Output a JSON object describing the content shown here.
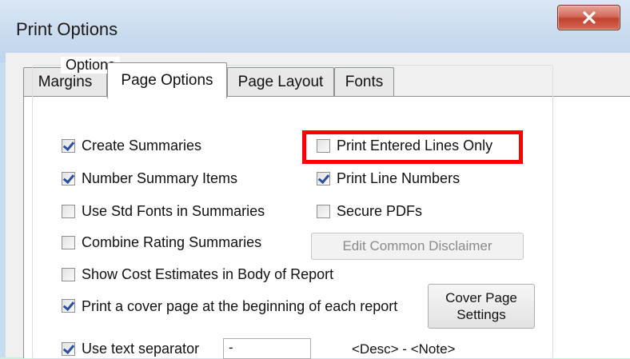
{
  "window": {
    "title": "Print Options",
    "close_label": "X"
  },
  "tabs": [
    {
      "label": "Margins",
      "active": false
    },
    {
      "label": "Page Options",
      "active": true
    },
    {
      "label": "Page Layout",
      "active": false
    },
    {
      "label": "Fonts",
      "active": false
    }
  ],
  "options_group": {
    "legend": "Options",
    "create_summaries": {
      "label": "Create Summaries",
      "checked": true
    },
    "number_summary_items": {
      "label": "Number Summary Items",
      "checked": true
    },
    "use_std_fonts": {
      "label": "Use Std Fonts in Summaries",
      "checked": false
    },
    "combine_rating": {
      "label": "Combine Rating Summaries",
      "checked": false
    },
    "show_cost": {
      "label": "Show Cost Estimates in Body of Report",
      "checked": false
    },
    "print_cover": {
      "label": "Print a cover page at the beginning of each report",
      "checked": true
    },
    "use_text_separator": {
      "label": "Use text separator",
      "checked": true
    },
    "print_entered_lines": {
      "label": "Print Entered Lines Only",
      "checked": false
    },
    "print_line_numbers": {
      "label": "Print Line Numbers",
      "checked": true
    },
    "secure_pdfs": {
      "label": "Secure PDFs",
      "checked": false
    }
  },
  "buttons": {
    "edit_disclaimer": "Edit Common Disclaimer",
    "cover_page_settings_line1": "Cover Page",
    "cover_page_settings_line2": "Settings"
  },
  "separator": {
    "value": "-",
    "hint": "<Desc> - <Note>"
  },
  "colors": {
    "highlight": "#ff0000",
    "checkmark": "#2a4fa0",
    "close_button": "#c1412f"
  }
}
